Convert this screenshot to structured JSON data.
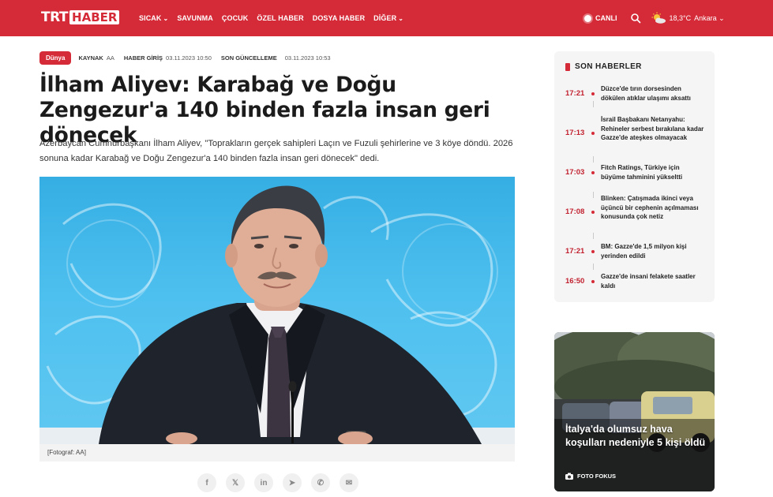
{
  "header": {
    "logo_trt": "TRT",
    "logo_haber": "HABER",
    "nav": [
      {
        "label": "SICAK",
        "has_chevron": true
      },
      {
        "label": "SAVUNMA",
        "has_chevron": false
      },
      {
        "label": "ÇOCUK",
        "has_chevron": false
      },
      {
        "label": "ÖZEL HABER",
        "has_chevron": false
      },
      {
        "label": "DOSYA HABER",
        "has_chevron": false
      },
      {
        "label": "DİĞER",
        "has_chevron": true
      }
    ],
    "live_label": "CANLI",
    "temperature": "18,3°C",
    "city": "Ankara",
    "icons": {
      "search": "search-icon",
      "weather": "sun-cloud-icon",
      "chevron": "chevron-down-icon"
    },
    "brand_color": "#d52a37"
  },
  "article": {
    "category": "Dünya",
    "source_label": "KAYNAK",
    "source_value": "AA",
    "published_label": "HABER GİRİŞ",
    "published_value": "03.11.2023 10:50",
    "updated_label": "SON GÜNCELLEME",
    "updated_value": "03.11.2023 10:53",
    "title": "İlham Aliyev: Karabağ ve Doğu Zengezur'a 140 binden fazla insan geri dönecek",
    "lead": "Azerbaycan Cumhurbaşkanı İlham Aliyev, \"Toprakların gerçek sahipleri Laçın ve Fuzuli şehirlerine ve 3 köye döndü. 2026 sonuna kadar Karabağ ve Doğu Zengezur'a 140 binden fazla insan geri dönecek\" dedi.",
    "caption": "[Fotograf: AA]",
    "share": [
      {
        "name": "facebook-icon",
        "glyph": "f"
      },
      {
        "name": "x-icon",
        "glyph": "𝕏"
      },
      {
        "name": "linkedin-icon",
        "glyph": "in"
      },
      {
        "name": "telegram-icon",
        "glyph": "➤"
      },
      {
        "name": "whatsapp-icon",
        "glyph": "✆"
      },
      {
        "name": "email-icon",
        "glyph": "✉"
      }
    ]
  },
  "sidebar": {
    "title": "SON HABERLER",
    "news": [
      {
        "time": "17:21",
        "text": "Düzce'de tırın dorsesinden dökülen atıklar ulaşımı aksattı"
      },
      {
        "time": "17:13",
        "text": "İsrail Başbakanı Netanyahu: Rehineler serbest bırakılana kadar Gazze'de ateşkes olmayacak"
      },
      {
        "time": "17:03",
        "text": "Fitch Ratings, Türkiye için büyüme tahminini yükseltti"
      },
      {
        "time": "17:08",
        "text": "Blinken: Çatışmada ikinci veya üçüncü bir cephenin açılmaması konusunda çok netiz"
      },
      {
        "time": "17:21",
        "text": "BM: Gazze'de 1,5 milyon kişi yerinden edildi"
      },
      {
        "time": "16:50",
        "text": "Gazze'de insani felakete saatler kaldı"
      }
    ],
    "photo": {
      "title": "İtalya'da olumsuz hava koşulları nedeniyle 5 kişi öldü",
      "badge": "FOTO FOKUS"
    }
  }
}
